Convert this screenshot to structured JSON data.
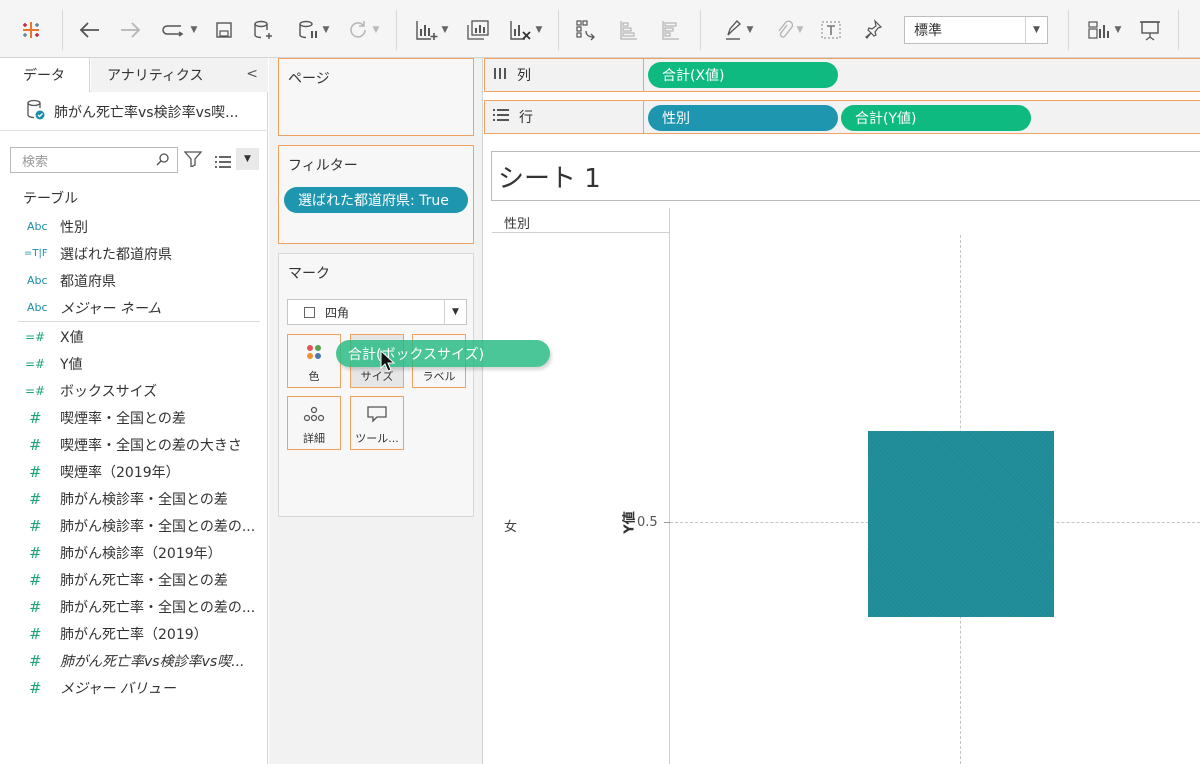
{
  "toolbar": {
    "mark_size_select": "標準"
  },
  "data_pane": {
    "tab_data": "データ",
    "tab_analytics": "アナリティクス",
    "collapse": "<",
    "source_name": "肺がん死亡率vs検診率vs喫...",
    "search_placeholder": "検索",
    "section_tables": "テーブル",
    "fields": [
      {
        "icon": "Abc",
        "name": "性別"
      },
      {
        "icon": "=T|F",
        "name": "選ばれた都道府県"
      },
      {
        "icon": "Abc",
        "name": "都道府県"
      },
      {
        "icon": "Abc",
        "name": "メジャー ネーム"
      },
      {
        "icon": "=#",
        "name": "X値"
      },
      {
        "icon": "=#",
        "name": "Y値"
      },
      {
        "icon": "=#",
        "name": "ボックスサイズ"
      },
      {
        "icon": "#",
        "name": "喫煙率・全国との差"
      },
      {
        "icon": "#",
        "name": "喫煙率・全国との差の大きさ"
      },
      {
        "icon": "#",
        "name": "喫煙率（2019年）"
      },
      {
        "icon": "#",
        "name": "肺がん検診率・全国との差"
      },
      {
        "icon": "#",
        "name": "肺がん検診率・全国との差の..."
      },
      {
        "icon": "#",
        "name": "肺がん検診率（2019年）"
      },
      {
        "icon": "#",
        "name": "肺がん死亡率・全国との差"
      },
      {
        "icon": "#",
        "name": "肺がん死亡率・全国との差の..."
      },
      {
        "icon": "#",
        "name": "肺がん死亡率（2019）"
      },
      {
        "icon": "#",
        "name": "肺がん死亡率vs検診率vs喫..."
      },
      {
        "icon": "#",
        "name": "メジャー バリュー"
      }
    ]
  },
  "shelves": {
    "pages_title": "ページ",
    "filters_title": "フィルター",
    "filter_pill": "選ばれた都道府県: True",
    "marks_title": "マーク",
    "mark_type": "四角",
    "mark_buttons": {
      "color": "色",
      "size": "サイズ",
      "label": "ラベル",
      "detail": "詳細",
      "tooltip": "ツール..."
    },
    "columns_label": "列",
    "columns_pill": "合計(X値)",
    "rows_label": "行",
    "rows_pill_1": "性別",
    "rows_pill_2": "合計(Y値)"
  },
  "drag": {
    "pill": "合計(ボックスサイズ)"
  },
  "viz": {
    "sheet_title": "シート 1",
    "header": "性別",
    "row_value": "女",
    "axis_title": "Y値",
    "tick": "0.5"
  },
  "colors": {
    "dimension_pill": "#1e96b0",
    "measure_pill": "#0fba80",
    "mark": "#21909c",
    "shelf_border": "#f0a262"
  }
}
